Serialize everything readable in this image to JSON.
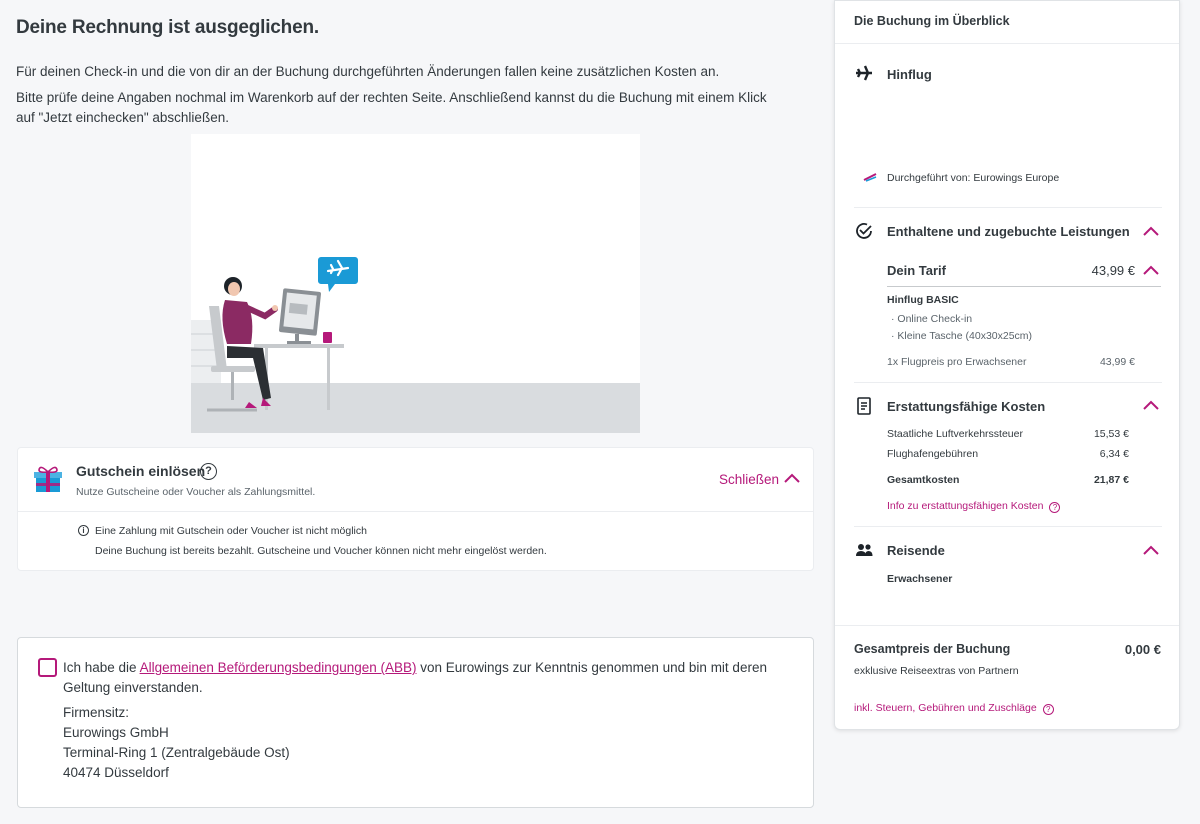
{
  "main": {
    "title": "Deine Rechnung ist ausgeglichen.",
    "intro_1": "Für deinen Check-in und die von dir an der Buchung durchgeführten Änderungen fallen keine zusätzlichen Kosten an.",
    "intro_2": "Bitte prüfe deine Angaben nochmal im Warenkorb auf der rechten Seite. Anschließend kannst du die Buchung mit einem Klick auf \"Jetzt einchecken\" abschließen."
  },
  "voucher": {
    "icon": "gift-icon",
    "title": "Gutschein einlösen",
    "help_glyph": "?",
    "subtitle": "Nutze Gutscheine oder Voucher als Zahlungsmittel.",
    "close_label": "Schließen",
    "info_glyph": "i",
    "note_1": "Eine Zahlung mit Gutschein oder Voucher ist nicht möglich",
    "note_2": "Deine Buchung ist bereits bezahlt. Gutscheine und Voucher können nicht mehr eingelöst werden."
  },
  "terms": {
    "text_before": "Ich habe die ",
    "link": "Allgemeinen Beförderungsbedingungen (ABB)",
    "text_after": " von Eurowings zur Kenntnis genommen und bin mit deren Geltung einverstanden.",
    "address": [
      "Firmensitz:",
      "Eurowings GmbH",
      "Terminal-Ring 1 (Zentralgebäude Ost)",
      "40474 Düsseldorf"
    ]
  },
  "summary": {
    "header": "Die Buchung im Überblick",
    "flight": {
      "icon": "airplane-icon",
      "title": "Hinflug",
      "operated_by": "Durchgeführt von: Eurowings Europe"
    },
    "services": {
      "icon": "check-circle-icon",
      "title": "Enthaltene und zugebuchte Leistungen",
      "tariff_label": "Dein Tarif",
      "tariff_price": "43,99 €",
      "fare_name": "Hinflug BASIC",
      "features": [
        "· Online Check-in",
        "· Kleine Tasche (40x30x25cm)"
      ],
      "line_label": "1x Flugpreis pro Erwachsener",
      "line_price": "43,99 €"
    },
    "refundable": {
      "icon": "document-icon",
      "title": "Erstattungsfähige Kosten",
      "rows": [
        {
          "label": "Staatliche Luftverkehrssteuer",
          "value": "15,53 €"
        },
        {
          "label": "Flughafengebühren",
          "value": "6,34 €"
        }
      ],
      "total_label": "Gesamtkosten",
      "total_value": "21,87 €",
      "info_link": "Info zu erstattungsfähigen Kosten"
    },
    "travellers": {
      "icon": "people-icon",
      "title": "Reisende",
      "type": "Erwachsener"
    },
    "total": {
      "label": "Gesamtpreis der Buchung",
      "value": "0,00 €",
      "note": "exklusive Reiseextras von Partnern",
      "info_link": "inkl. Steuern, Gebühren und Zuschläge"
    }
  },
  "colors": {
    "accent": "#b5197a",
    "text": "#333a3f",
    "background": "#f6f7f9",
    "sky_blue": "#1a9ad6"
  }
}
